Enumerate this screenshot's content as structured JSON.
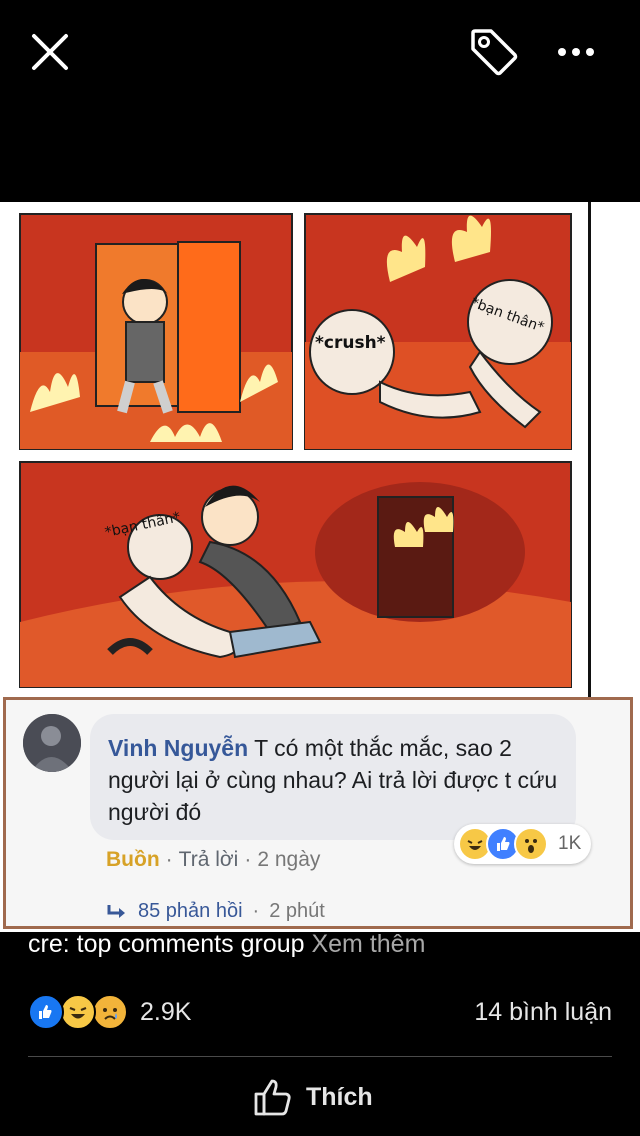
{
  "topbar": {
    "close_icon": "close-icon",
    "tag_icon": "tag-icon",
    "more_icon": "more-horizontal-icon"
  },
  "comic": {
    "labels": [
      "*crush*",
      "*bạn thân*",
      "*bạn thân*"
    ]
  },
  "comment": {
    "author": "Vinh Nguyễn",
    "text": "T có một thắc mắc, sao 2 người lại ở cùng nhau? Ai trả lời được t cứu người đó",
    "reaction_count": "1K",
    "reaction_label": "Buồn",
    "reply_label": "Trả lời",
    "time": "2 ngày",
    "replies_text": "85 phản hồi",
    "replies_time": "2 phút"
  },
  "post": {
    "caption": "cre: top comments group",
    "see_more": "Xem thêm",
    "reaction_count": "2.9K",
    "comment_count": "14 bình luận",
    "like_label": "Thích"
  },
  "colors": {
    "fb_blue": "#385898",
    "haha_yellow": "#f7c846",
    "sad_yellow": "#f2b43a",
    "comic_red": "#c8351f"
  }
}
